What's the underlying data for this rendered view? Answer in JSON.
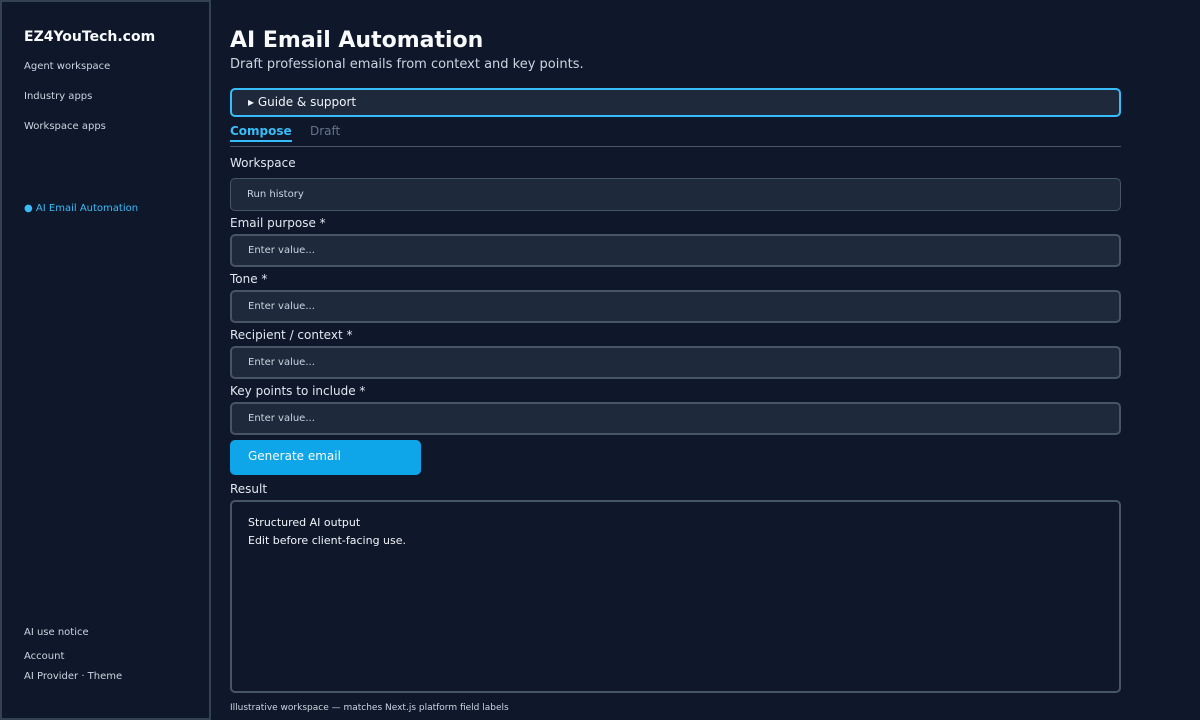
{
  "sidebar": {
    "brand": "EZ4YouTech.com",
    "nav": [
      {
        "label": "Agent workspace"
      },
      {
        "label": "Industry apps"
      },
      {
        "label": "Workspace apps"
      }
    ],
    "active_item": {
      "bullet": "●",
      "label": "AI Email Automation"
    },
    "footer": [
      {
        "label": "AI use notice"
      },
      {
        "label": "Account"
      },
      {
        "label": "AI Provider · Theme"
      }
    ]
  },
  "header": {
    "title": "AI Email Automation",
    "subtitle": "Draft professional emails from context and key points."
  },
  "guide": {
    "label": "▸ Guide & support"
  },
  "tabs": [
    {
      "label": "Compose",
      "active": true
    },
    {
      "label": "Draft",
      "active": false
    }
  ],
  "form": {
    "workspace": {
      "label": "Workspace",
      "value": "Run history"
    },
    "fields": [
      {
        "label": "Email purpose *",
        "placeholder": "Enter value..."
      },
      {
        "label": "Tone *",
        "placeholder": "Enter value..."
      },
      {
        "label": "Recipient / context *",
        "placeholder": "Enter value..."
      },
      {
        "label": "Key points to include *",
        "placeholder": "Enter value..."
      }
    ],
    "submit_label": "Generate email"
  },
  "result": {
    "label": "Result",
    "lines": [
      "Structured AI output",
      "Edit before client-facing use."
    ]
  },
  "footnote": "Illustrative workspace — matches Next.js platform field labels",
  "colors": {
    "background": "#0f172a",
    "panel": "#1e293b",
    "accent": "#38bdf8",
    "button": "#0ea5e9",
    "border": "#475569"
  }
}
